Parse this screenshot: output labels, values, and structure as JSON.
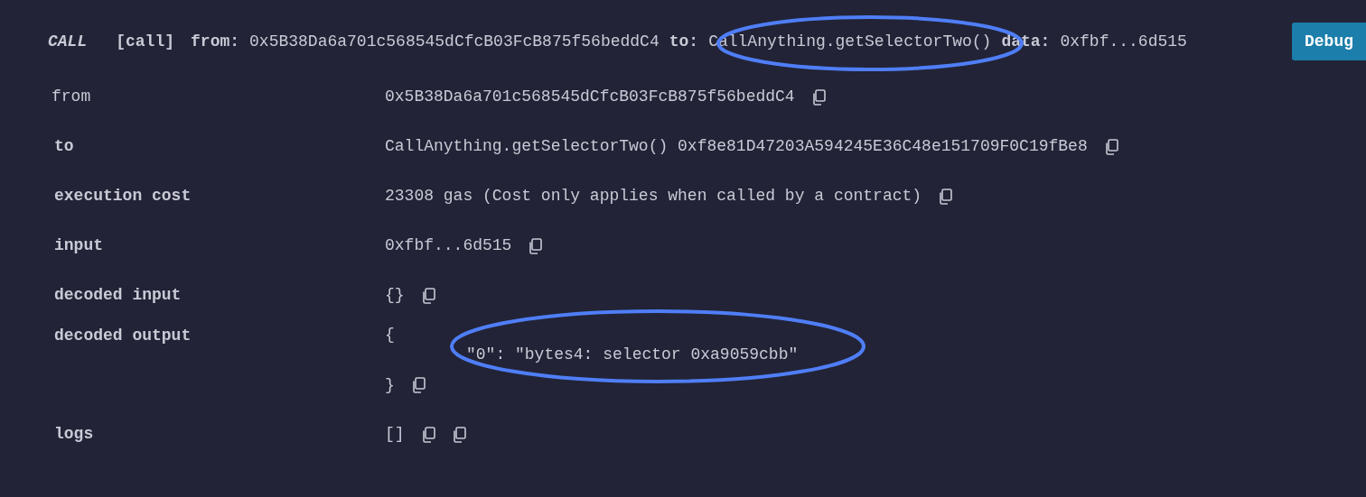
{
  "header": {
    "type_label": "CALL",
    "tag": "[call]",
    "from_label": "from:",
    "from_value": "0x5B38Da6a701c568545dCfcB03FcB875f56beddC4",
    "to_label": "to:",
    "to_value": "CallAnything.getSelectorTwo()",
    "data_label": "data:",
    "data_value": "0xfbf...6d515"
  },
  "debug_button": "Debug",
  "rows": [
    {
      "label": "from",
      "bold": false,
      "kind": "plain",
      "value": "0x5B38Da6a701c568545dCfcB03FcB875f56beddC4"
    },
    {
      "label": "to",
      "bold": true,
      "kind": "plain",
      "value": "CallAnything.getSelectorTwo() 0xf8e81D47203A594245E36C48e151709F0C19fBe8"
    },
    {
      "label": "execution cost",
      "bold": true,
      "kind": "plain",
      "value": "23308 gas (Cost only applies when called by a contract)"
    },
    {
      "label": "input",
      "bold": true,
      "kind": "plain",
      "value": "0xfbf...6d515"
    },
    {
      "label": "decoded input",
      "bold": true,
      "kind": "plain",
      "value": "{}"
    },
    {
      "label": "decoded output",
      "bold": true,
      "kind": "object",
      "open": "{",
      "entries": [
        "\"0\": \"bytes4: selector 0xa9059cbb\""
      ],
      "close": "}"
    },
    {
      "label": "logs",
      "bold": true,
      "kind": "logs",
      "value": "[]"
    }
  ]
}
